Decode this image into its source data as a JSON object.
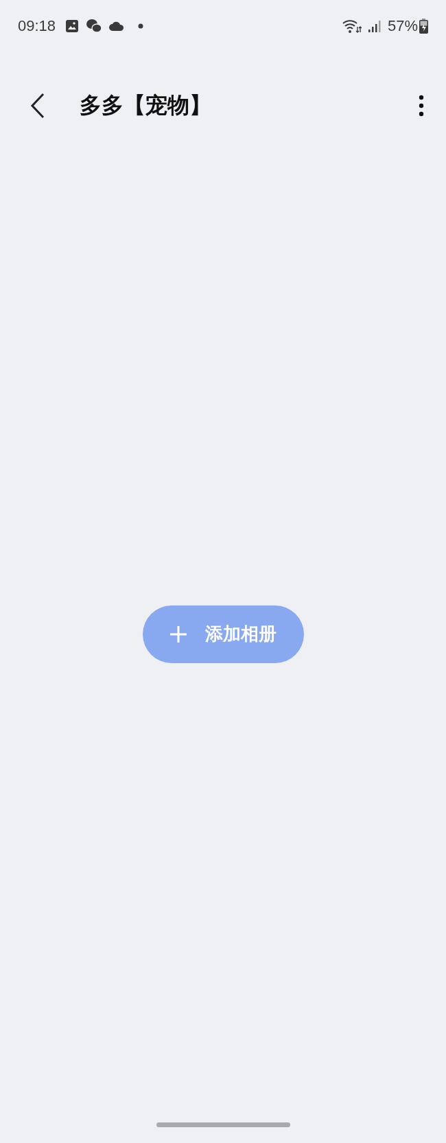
{
  "status_bar": {
    "time": "09:18",
    "battery": "57%"
  },
  "header": {
    "title": "多多【宠物】"
  },
  "add_button": {
    "label": "添加相册"
  }
}
